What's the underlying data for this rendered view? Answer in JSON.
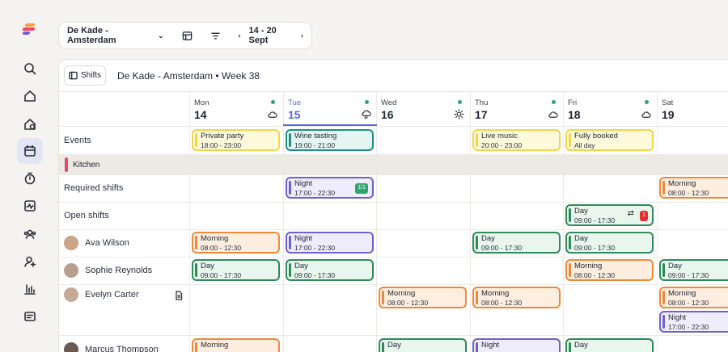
{
  "toolbar": {
    "location": "De Kade - Amsterdam",
    "date_range": "14 - 20 Sept",
    "prev": "‹",
    "next": "›",
    "caret": "⌄"
  },
  "panel": {
    "shifts_button": "Shifts",
    "title": "De Kade - Amsterdam • Week 38"
  },
  "days": [
    {
      "name": "Mon",
      "num": "14",
      "weather": "cloud"
    },
    {
      "name": "Tue",
      "num": "15",
      "weather": "rain"
    },
    {
      "name": "Wed",
      "num": "16",
      "weather": "sun"
    },
    {
      "name": "Thu",
      "num": "17",
      "weather": "cloud"
    },
    {
      "name": "Fri",
      "num": "18",
      "weather": "cloud"
    },
    {
      "name": "Sat",
      "num": "19",
      "weather": ""
    }
  ],
  "rows": {
    "events": "Events",
    "section": "Kitchen",
    "required": "Required shifts",
    "open": "Open shifts",
    "people": [
      "Ava Wilson",
      "Sophie Reynolds",
      "Evelyn Carter",
      "Marcus Thompson"
    ]
  },
  "events": [
    {
      "title": "Private party",
      "time": "18:00 - 23:00"
    },
    {
      "title": "Wine tasting",
      "time": "19:00 - 21:00"
    },
    {
      "title": "Live music",
      "time": "20:00 - 23:00"
    },
    {
      "title": "Fully booked",
      "time": "All day"
    }
  ],
  "shifts": {
    "night": "Night",
    "day": "Day",
    "morning": "Morning",
    "night_time": "17:00 - 22:30",
    "day_time": "09:00 - 17:30",
    "morning_time": "08:00 - 12:30",
    "required_badge": "1/1",
    "open_badge": "1",
    "swap": "⇄"
  },
  "colors": {
    "accent": "#5668d4",
    "kitchen": "#e8476a",
    "yellow": "#f1d54e",
    "teal": "#1f8f84",
    "purple": "#7160c9",
    "orange": "#ec8a3c",
    "green": "#2e8a57"
  },
  "icons": [
    "logo-icon",
    "search-icon",
    "home-icon",
    "location-icon",
    "calendar-icon",
    "timer-icon",
    "activity-icon",
    "team-icon",
    "add-user-icon",
    "chart-icon",
    "id-card-icon"
  ]
}
